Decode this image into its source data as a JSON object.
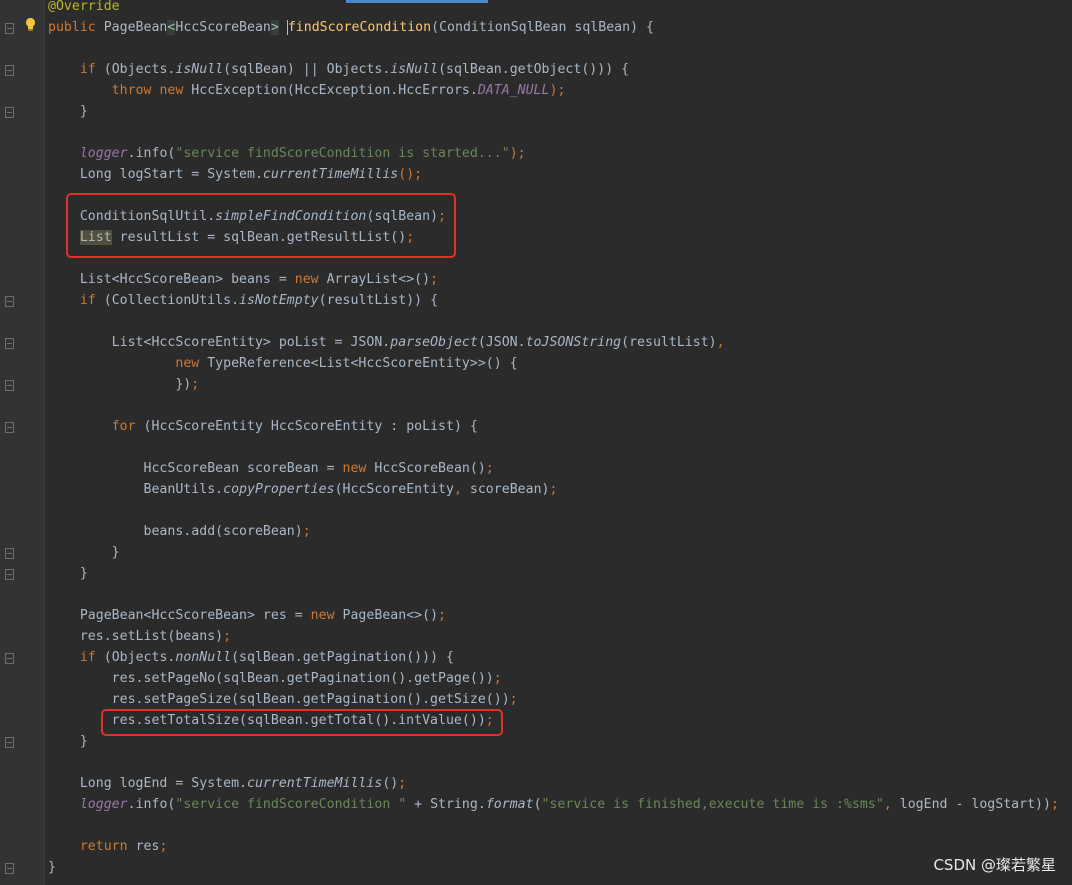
{
  "editor": {
    "lines": [
      {
        "tokens": [
          {
            "t": "@Override",
            "c": "ann"
          }
        ]
      },
      {
        "tokens": [
          {
            "t": "public ",
            "c": "kw"
          },
          {
            "t": "PageBean"
          },
          {
            "t": "<",
            "c": "hl"
          },
          {
            "t": "HccScoreBean"
          },
          {
            "t": ">",
            "c": "hl"
          },
          {
            "t": " "
          },
          {
            "t": "findScoreCondition",
            "c": "fn caret"
          },
          {
            "t": "(ConditionSqlBean sqlBean) {"
          }
        ]
      },
      {
        "tokens": []
      },
      {
        "tokens": [
          {
            "t": "    "
          },
          {
            "t": "if ",
            "c": "kw"
          },
          {
            "t": "(Objects."
          },
          {
            "t": "isNull",
            "c": "it"
          },
          {
            "t": "(sqlBean) || Objects."
          },
          {
            "t": "isNull",
            "c": "it"
          },
          {
            "t": "(sqlBean.getObject())) {"
          }
        ]
      },
      {
        "tokens": [
          {
            "t": "        "
          },
          {
            "t": "throw new ",
            "c": "kw"
          },
          {
            "t": "HccException(HccException.HccErrors."
          },
          {
            "t": "DATA_NULL",
            "c": "fld"
          },
          {
            "t": ");",
            "c": "kw"
          }
        ]
      },
      {
        "tokens": [
          {
            "t": "    }"
          }
        ]
      },
      {
        "tokens": []
      },
      {
        "tokens": [
          {
            "t": "    "
          },
          {
            "t": "logger",
            "c": "fld"
          },
          {
            "t": ".info("
          },
          {
            "t": "\"service findScoreCondition is started...\"",
            "c": "str"
          },
          {
            "t": ");",
            "c": "kw"
          }
        ]
      },
      {
        "tokens": [
          {
            "t": "    Long logStart = System."
          },
          {
            "t": "currentTimeMillis",
            "c": "it"
          },
          {
            "t": "();",
            "c": "kw"
          }
        ]
      },
      {
        "tokens": []
      },
      {
        "tokens": [
          {
            "t": "    ConditionSqlUtil."
          },
          {
            "t": "simpleFindCondition",
            "c": "it"
          },
          {
            "t": "(sqlBean)"
          },
          {
            "t": ";",
            "c": "kw"
          }
        ]
      },
      {
        "tokens": [
          {
            "t": "    "
          },
          {
            "t": "List",
            "c": "hl2"
          },
          {
            "t": " resultList = sqlBean.getResultList()"
          },
          {
            "t": ";",
            "c": "kw"
          }
        ]
      },
      {
        "tokens": []
      },
      {
        "tokens": [
          {
            "t": "    List<HccScoreBean> beans = "
          },
          {
            "t": "new ",
            "c": "kw"
          },
          {
            "t": "ArrayList<>()"
          },
          {
            "t": ";",
            "c": "kw"
          }
        ]
      },
      {
        "tokens": [
          {
            "t": "    "
          },
          {
            "t": "if ",
            "c": "kw"
          },
          {
            "t": "(CollectionUtils."
          },
          {
            "t": "isNotEmpty",
            "c": "it"
          },
          {
            "t": "(resultList)) {"
          }
        ]
      },
      {
        "tokens": []
      },
      {
        "tokens": [
          {
            "t": "        List<HccScoreEntity> poList = JSON."
          },
          {
            "t": "parseObject",
            "c": "it"
          },
          {
            "t": "(JSON."
          },
          {
            "t": "toJSONString",
            "c": "it"
          },
          {
            "t": "(resultList)"
          },
          {
            "t": ",",
            "c": "kw"
          }
        ]
      },
      {
        "tokens": [
          {
            "t": "                "
          },
          {
            "t": "new ",
            "c": "kw"
          },
          {
            "t": "TypeReference<List<HccScoreEntity>>() {"
          }
        ]
      },
      {
        "tokens": [
          {
            "t": "                })"
          },
          {
            "t": ";",
            "c": "kw"
          }
        ]
      },
      {
        "tokens": []
      },
      {
        "tokens": [
          {
            "t": "        "
          },
          {
            "t": "for ",
            "c": "kw"
          },
          {
            "t": "(HccScoreEntity HccScoreEntity : poList) {"
          }
        ]
      },
      {
        "tokens": []
      },
      {
        "tokens": [
          {
            "t": "            HccScoreBean scoreBean = "
          },
          {
            "t": "new ",
            "c": "kw"
          },
          {
            "t": "HccScoreBean()"
          },
          {
            "t": ";",
            "c": "kw"
          }
        ]
      },
      {
        "tokens": [
          {
            "t": "            BeanUtils."
          },
          {
            "t": "copyProperties",
            "c": "it"
          },
          {
            "t": "(HccScoreEntity"
          },
          {
            "t": ", ",
            "c": "kw"
          },
          {
            "t": "scoreBean)"
          },
          {
            "t": ";",
            "c": "kw"
          }
        ]
      },
      {
        "tokens": []
      },
      {
        "tokens": [
          {
            "t": "            beans.add(scoreBean)"
          },
          {
            "t": ";",
            "c": "kw"
          }
        ]
      },
      {
        "tokens": [
          {
            "t": "        }"
          }
        ]
      },
      {
        "tokens": [
          {
            "t": "    }"
          }
        ]
      },
      {
        "tokens": []
      },
      {
        "tokens": [
          {
            "t": "    PageBean<HccScoreBean> res = "
          },
          {
            "t": "new ",
            "c": "kw"
          },
          {
            "t": "PageBean<>()"
          },
          {
            "t": ";",
            "c": "kw"
          }
        ]
      },
      {
        "tokens": [
          {
            "t": "    res.setList(beans)"
          },
          {
            "t": ";",
            "c": "kw"
          }
        ]
      },
      {
        "tokens": [
          {
            "t": "    "
          },
          {
            "t": "if ",
            "c": "kw"
          },
          {
            "t": "(Objects."
          },
          {
            "t": "nonNull",
            "c": "it"
          },
          {
            "t": "(sqlBean.getPagination())) {"
          }
        ]
      },
      {
        "tokens": [
          {
            "t": "        res.setPageNo(sqlBean.getPagination().getPage())"
          },
          {
            "t": ";",
            "c": "kw"
          }
        ]
      },
      {
        "tokens": [
          {
            "t": "        res.setPageSize(sqlBean.getPagination().getSize())"
          },
          {
            "t": ";",
            "c": "kw"
          }
        ]
      },
      {
        "tokens": [
          {
            "t": "        res.setTotalSize(sqlBean.getTotal().intValue())"
          },
          {
            "t": ";",
            "c": "kw"
          }
        ]
      },
      {
        "tokens": [
          {
            "t": "    }"
          }
        ]
      },
      {
        "tokens": []
      },
      {
        "tokens": [
          {
            "t": "    Long logEnd = System."
          },
          {
            "t": "currentTimeMillis",
            "c": "it"
          },
          {
            "t": "()"
          },
          {
            "t": ";",
            "c": "kw"
          }
        ]
      },
      {
        "tokens": [
          {
            "t": "    "
          },
          {
            "t": "logger",
            "c": "fld"
          },
          {
            "t": ".info("
          },
          {
            "t": "\"service findScoreCondition \"",
            "c": "str"
          },
          {
            "t": " + String."
          },
          {
            "t": "format",
            "c": "it"
          },
          {
            "t": "("
          },
          {
            "t": "\"service is finished,execute time is :%sms\"",
            "c": "str"
          },
          {
            "t": ", ",
            "c": "kw"
          },
          {
            "t": "logEnd - logStart))"
          },
          {
            "t": ";",
            "c": "kw"
          }
        ]
      },
      {
        "tokens": []
      },
      {
        "tokens": [
          {
            "t": "    "
          },
          {
            "t": "return ",
            "c": "kw"
          },
          {
            "t": "res"
          },
          {
            "t": ";",
            "c": "kw"
          }
        ]
      },
      {
        "tokens": [
          {
            "t": "}"
          }
        ]
      }
    ]
  },
  "gutter": {
    "icons": [
      "bulb-icon",
      "fold-icon"
    ]
  },
  "watermark": "CSDN @璨若繁星"
}
